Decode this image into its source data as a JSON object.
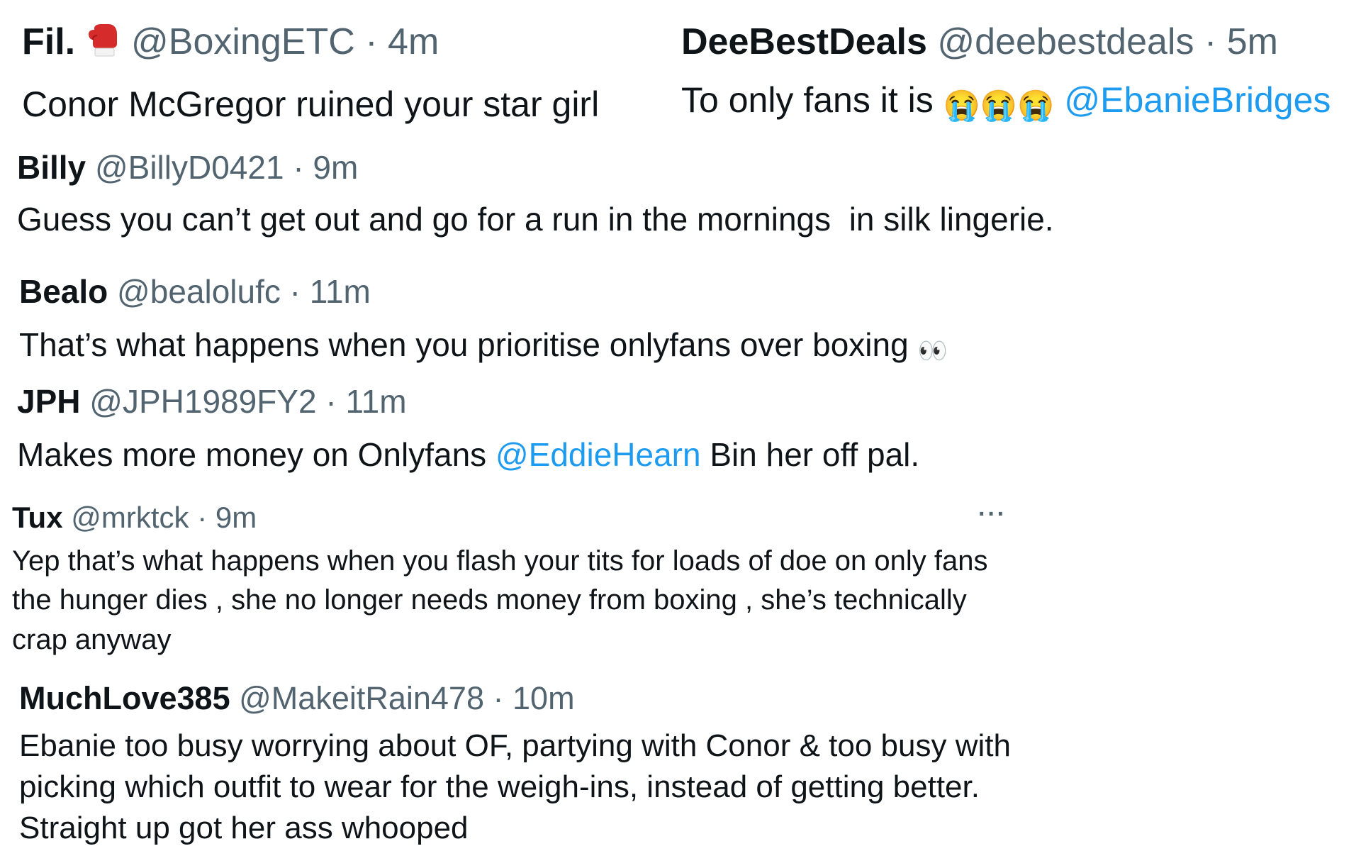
{
  "replies": [
    {
      "name": "Fil.",
      "handle": "@BoxingETC",
      "separator": "·",
      "time": "4m",
      "text": "Conor McGregor ruined your star girl"
    },
    {
      "name": "DeeBestDeals",
      "handle": "@deebestdeals",
      "separator": "·",
      "time": "5m",
      "text": "To only fans it is",
      "emoji": "😭😭😭",
      "mention": "@EbanieBridges"
    },
    {
      "name": "Billy",
      "handle": "@BillyD0421",
      "separator": "·",
      "time": "9m",
      "text": "Guess you can’t get out and go for a run in the mornings  in silk lingerie."
    },
    {
      "name": "Bealo",
      "handle": "@bealolufc",
      "separator": "·",
      "time": "11m",
      "text": "That’s what happens when you prioritise onlyfans over boxing",
      "emoji": "👀"
    },
    {
      "name": "JPH",
      "handle": "@JPH1989FY2",
      "separator": "·",
      "time": "11m",
      "text_before": "Makes more money on Onlyfans",
      "mention": "@EddieHearn",
      "text_after": "Bin her off pal."
    },
    {
      "name": "Tux",
      "handle": "@mrktck",
      "separator": "·",
      "time": "9m",
      "more": "···",
      "text": "Yep that’s what happens when you flash your tits for loads of doe on only fans the hunger dies , she no longer needs money from boxing , she’s technically crap anyway"
    },
    {
      "name": "MuchLove385",
      "handle": "@MakeitRain478",
      "separator": "·",
      "time": "10m",
      "text": "Ebanie too busy worrying about OF, partying with Conor & too busy with picking which outfit to wear for the weigh-ins, instead of getting better. Straight up got her ass whooped"
    }
  ],
  "colors": {
    "text": "#0f1419",
    "secondary": "#536471",
    "link": "#1d9bf0",
    "background": "#ffffff"
  },
  "icons": {
    "boxing_glove": "boxing-glove-icon",
    "more": "more-options-icon"
  }
}
